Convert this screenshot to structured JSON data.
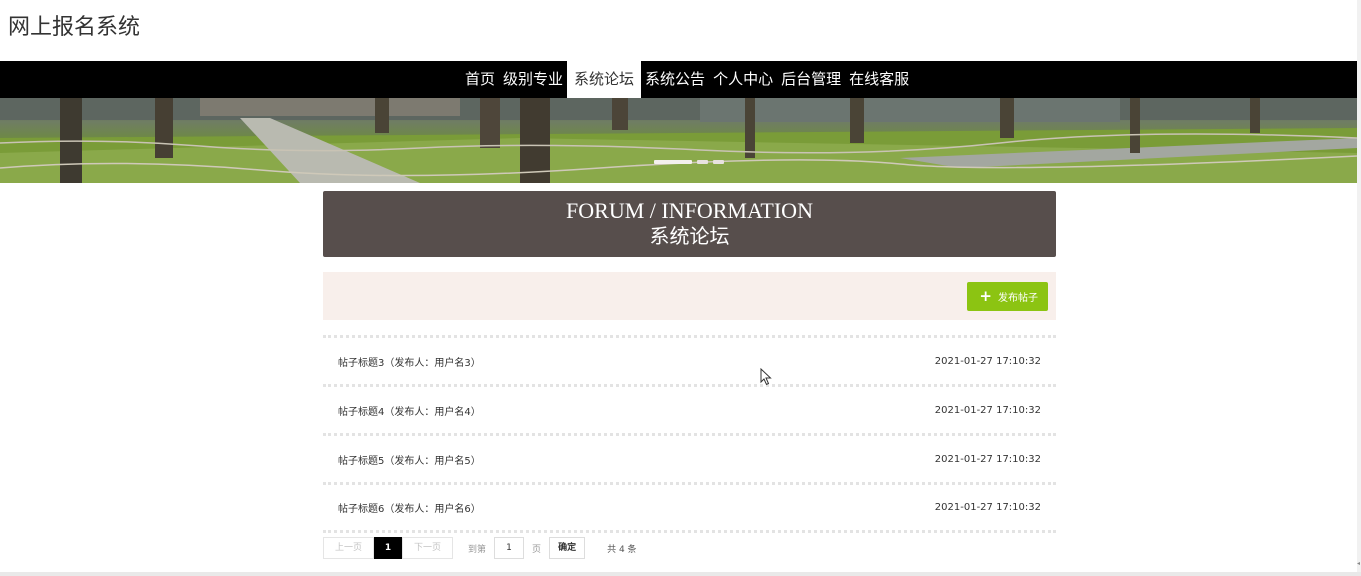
{
  "site": {
    "title": "网上报名系统"
  },
  "nav": {
    "items": [
      {
        "label": "首页",
        "active": false
      },
      {
        "label": "级别专业",
        "active": false
      },
      {
        "label": "系统论坛",
        "active": true
      },
      {
        "label": "系统公告",
        "active": false
      },
      {
        "label": "个人中心",
        "active": false
      },
      {
        "label": "后台管理",
        "active": false
      },
      {
        "label": "在线客服",
        "active": false
      }
    ]
  },
  "banner": {
    "slides": 3,
    "active_slide": 1
  },
  "forum": {
    "title_en": "FORUM / INFORMATION",
    "title_cn": "系统论坛",
    "publish_label": "发布帖子",
    "publish_icon": "plus-icon",
    "posts": [
      {
        "title": "帖子标题3（发布人：用户名3）",
        "time": "2021-01-27 17:10:32"
      },
      {
        "title": "帖子标题4（发布人：用户名4）",
        "time": "2021-01-27 17:10:32"
      },
      {
        "title": "帖子标题5（发布人：用户名5）",
        "time": "2021-01-27 17:10:32"
      },
      {
        "title": "帖子标题6（发布人：用户名6）",
        "time": "2021-01-27 17:10:32"
      }
    ]
  },
  "pager": {
    "prev_label": "上一页",
    "current_page": "1",
    "next_label": "下一页",
    "goto_label": "到第",
    "goto_value": "1",
    "page_unit": "页",
    "confirm_label": "确定",
    "total_label": "共 4 条"
  },
  "colors": {
    "nav_bg": "#000000",
    "header_bg": "#574e4c",
    "toolbar_bg": "#f8efeb",
    "publish_btn": "#8cc412"
  }
}
